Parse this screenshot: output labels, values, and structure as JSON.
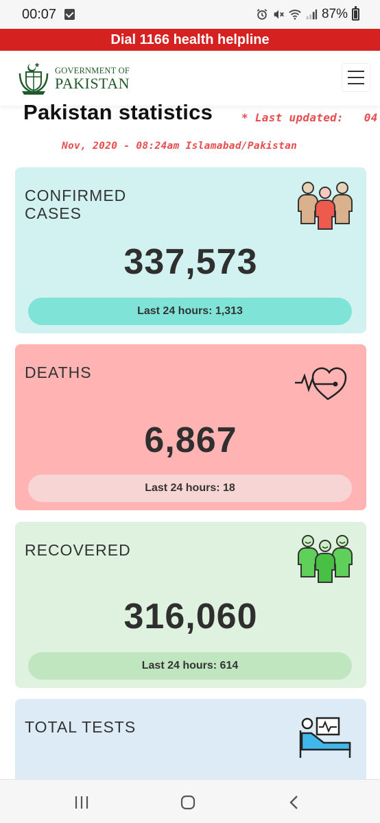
{
  "status_bar": {
    "time": "00:07",
    "battery_percent": "87%",
    "icons": [
      "check-icon",
      "alarm-icon",
      "mute-icon",
      "wifi-icon",
      "signal-icon",
      "battery-icon"
    ]
  },
  "helpline": {
    "text": "Dial 1166 health helpline",
    "color": "#d62121"
  },
  "header": {
    "logo_line1": "GOVERNMENT OF",
    "logo_line2": "PAKISTAN",
    "menu_icon": "hamburger-menu-icon"
  },
  "page": {
    "title": "Pakistan statistics",
    "updated_line1": "* Last updated:   04",
    "updated_line2": "Nov, 2020 - 08:24am Islamabad/Pakistan"
  },
  "cards": {
    "confirmed": {
      "label_line1": "CONFIRMED",
      "label_line2": "CASES",
      "value": "337,573",
      "last24": "Last 24 hours: 1,313",
      "icon": "people-group-icon",
      "bg_color": "#d2f2f2",
      "pill_color": "#7fe3d8"
    },
    "deaths": {
      "label": "DEATHS",
      "value": "6,867",
      "last24": "Last 24 hours: 18",
      "icon": "heartbeat-icon",
      "bg_color": "#ffb3b3",
      "pill_color": "#f8d5d5"
    },
    "recovered": {
      "label": "RECOVERED",
      "value": "316,060",
      "last24": "Last 24 hours: 614",
      "icon": "happy-people-icon",
      "bg_color": "#dff2df",
      "pill_color": "#bfe6bf"
    },
    "tests": {
      "label": "TOTAL TESTS",
      "icon": "hospital-bed-icon",
      "bg_color": "#dcebf5"
    }
  },
  "nav_bar": {
    "icons": [
      "recent-apps-icon",
      "home-icon",
      "back-icon"
    ]
  }
}
